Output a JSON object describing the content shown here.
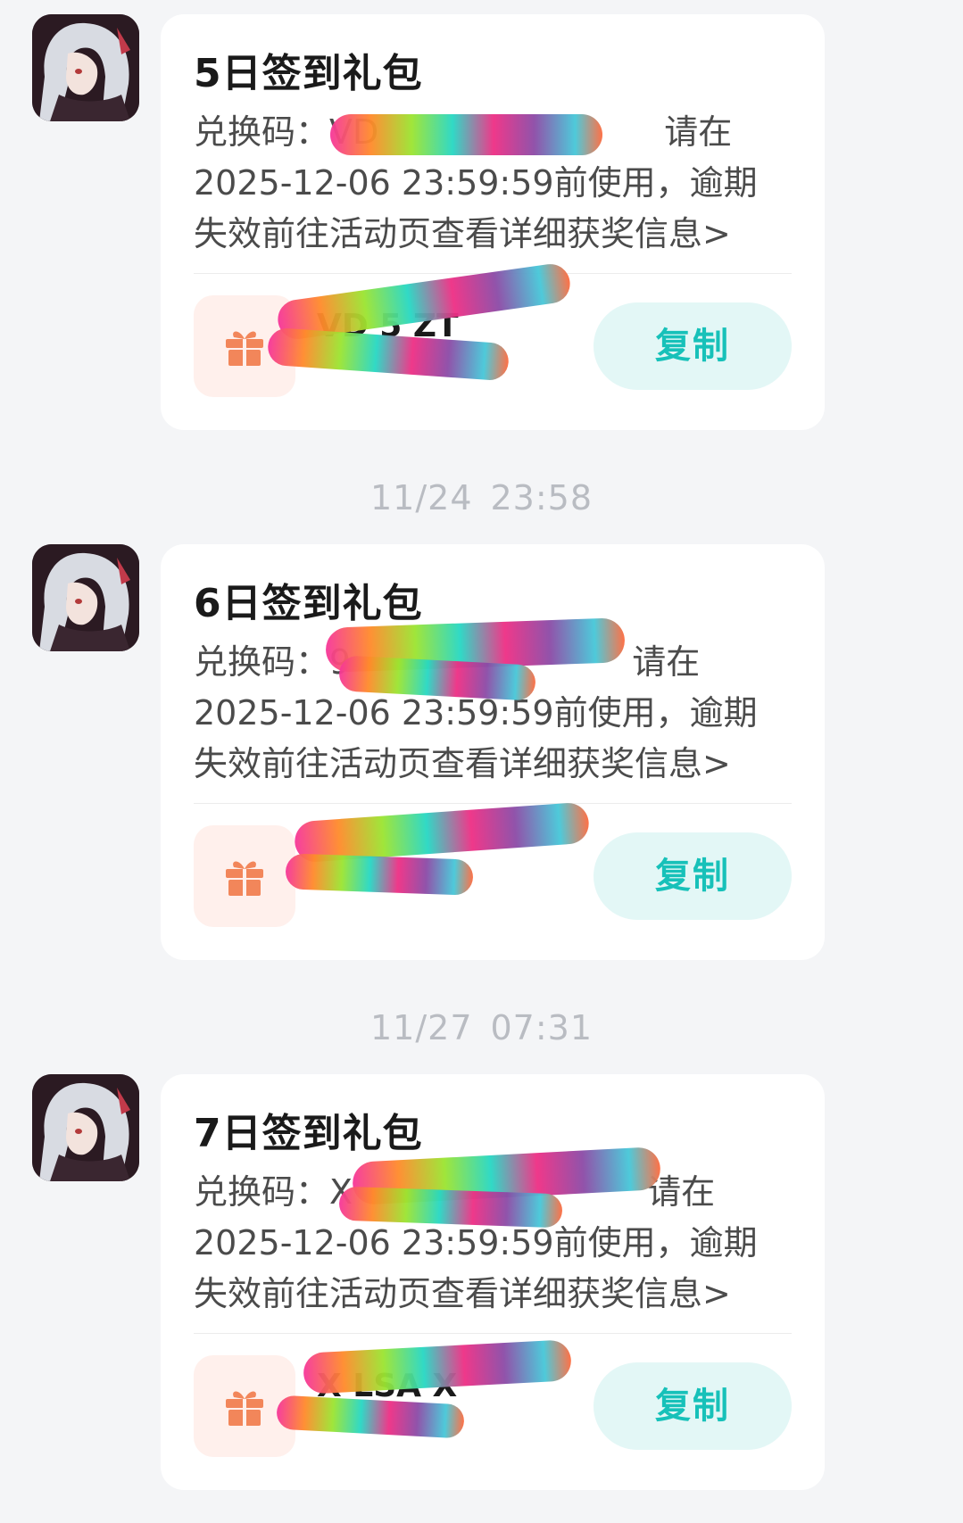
{
  "messages": [
    {
      "title": "5日签到礼包",
      "code_prefix": "兑换码：",
      "code_visible": "VD",
      "line1_suffix": "请在",
      "line2": "2025-12-06 23:59:59前使用，逾期",
      "line3": "失效前往活动页查看详细获奖信息>",
      "gift_code": "VD      5 ZT",
      "copy_label": "复制"
    },
    {
      "title": "6日签到礼包",
      "code_prefix": "兑换码：",
      "code_visible": "9",
      "line1_suffix": "请在",
      "line2": "2025-12-06 23:59:59前使用，逾期",
      "line3": "失效前往活动页查看详细获奖信息>",
      "gift_code": "",
      "copy_label": "复制"
    },
    {
      "title": "7日签到礼包",
      "code_prefix": "兑换码：",
      "code_visible": "X",
      "line1_suffix": "请在",
      "line2": "2025-12-06 23:59:59前使用，逾期",
      "line3": "失效前往活动页查看详细获奖信息>",
      "gift_code": "X    LSA X",
      "copy_label": "复制"
    }
  ],
  "timestamps": [
    {
      "date": "11/24",
      "time": "23:58"
    },
    {
      "date": "11/27",
      "time": "07:31"
    }
  ],
  "icons": {
    "avatar": "game-character-avatar",
    "gift": "gift-icon"
  },
  "colors": {
    "background": "#f4f5f7",
    "card": "#ffffff",
    "accent": "#17c1b9",
    "copy_bg": "#e3f7f6",
    "gift_bg": "#fff0ec",
    "gift_icon": "#f2865a",
    "timestamp": "#b9bcc2"
  }
}
